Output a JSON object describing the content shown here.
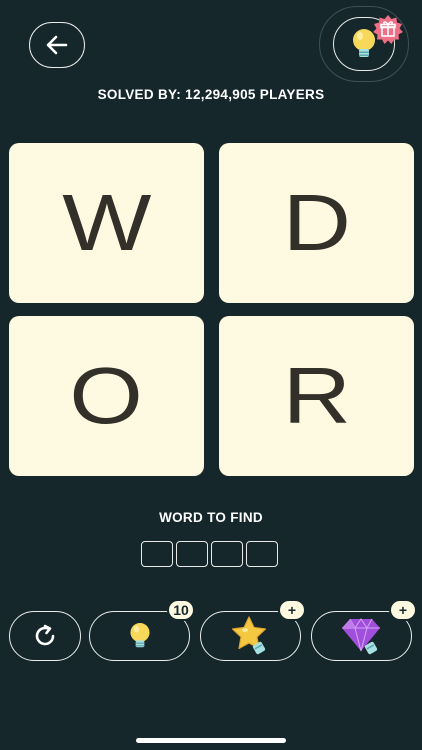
{
  "header": {
    "back_icon": "arrow-left-icon",
    "hint_icon": "lightbulb-icon",
    "gift_icon": "gift-icon"
  },
  "solved": {
    "text": "SOLVED BY: 12,294,905 PLAYERS"
  },
  "tiles": [
    {
      "letter": "W"
    },
    {
      "letter": "D"
    },
    {
      "letter": "O"
    },
    {
      "letter": "R"
    }
  ],
  "word_to_find": {
    "label": "WORD TO FIND",
    "slot_count": 4
  },
  "toolbar": {
    "refresh_icon": "refresh-icon",
    "hint": {
      "icon": "lightbulb-icon",
      "badge": "10"
    },
    "star": {
      "icon": "star-lightbulb-icon",
      "badge": "+"
    },
    "gem": {
      "icon": "gem-lightbulb-icon",
      "badge": "+"
    }
  },
  "colors": {
    "background": "#16272b",
    "tile": "#fef9e1",
    "tile_letter": "#333029",
    "outline": "#e8ebe9",
    "gift_badge": "#ef6f86",
    "bulb": "#f6d85a",
    "star": "#f5c842",
    "gem": "#a04fdc"
  }
}
